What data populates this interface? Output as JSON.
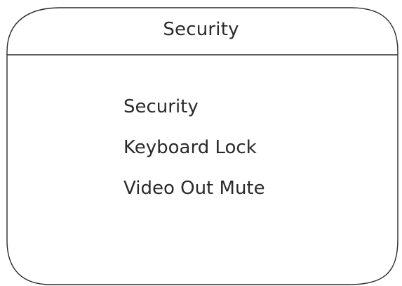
{
  "window": {
    "title": "Security"
  },
  "menu": {
    "items": [
      {
        "label": "Security"
      },
      {
        "label": "Keyboard Lock"
      },
      {
        "label": "Video Out Mute"
      }
    ]
  }
}
